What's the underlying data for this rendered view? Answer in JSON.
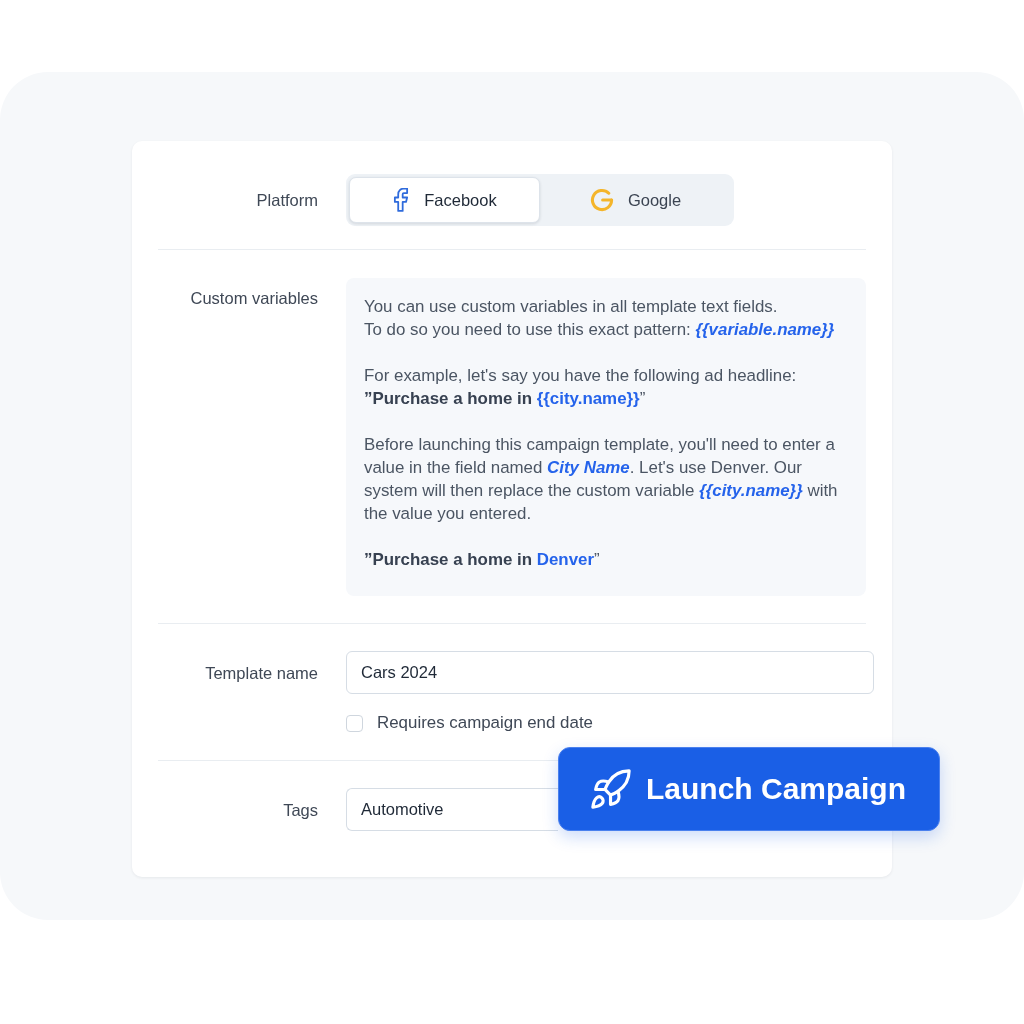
{
  "platform": {
    "label": "Platform",
    "options": [
      {
        "label": "Facebook",
        "selected": true
      },
      {
        "label": "Google",
        "selected": false
      }
    ]
  },
  "custom_variables": {
    "label": "Custom variables",
    "paragraphs": [
      {
        "lines": [
          [
            {
              "kind": "plain",
              "text": "You can use custom variables in all template text fields."
            }
          ],
          [
            {
              "kind": "plain",
              "text": "To do so you need to use this exact pattern: "
            },
            {
              "kind": "variable",
              "text": "{{variable.name}}"
            }
          ]
        ]
      },
      {
        "lines": [
          [
            {
              "kind": "plain",
              "text": "For example, let's say you have the following ad headline:"
            }
          ],
          [
            {
              "kind": "bold",
              "text": "”Purchase a home in "
            },
            {
              "kind": "highlight",
              "text": "{{city.name}}"
            },
            {
              "kind": "plain",
              "text": "”"
            }
          ]
        ]
      },
      {
        "lines": [
          [
            {
              "kind": "plain",
              "text": "Before launching this campaign template, you'll need to enter a value in the field named "
            },
            {
              "kind": "variable",
              "text": "City Name"
            },
            {
              "kind": "plain",
              "text": ". Let's use Denver. Our system will then replace the custom variable "
            },
            {
              "kind": "variable",
              "text": "{{city.name}}"
            },
            {
              "kind": "plain",
              "text": " with the value you entered."
            }
          ]
        ]
      },
      {
        "lines": [
          [
            {
              "kind": "bold",
              "text": "”Purchase a home in "
            },
            {
              "kind": "highlight",
              "text": "Denver"
            },
            {
              "kind": "plain",
              "text": "”"
            }
          ]
        ]
      }
    ]
  },
  "template_name": {
    "label": "Template name",
    "value": "Cars 2024"
  },
  "end_date": {
    "label": "Requires campaign end date",
    "checked": false
  },
  "tags": {
    "label": "Tags",
    "value": "Automotive"
  },
  "launch_button": {
    "label": "Launch Campaign"
  }
}
